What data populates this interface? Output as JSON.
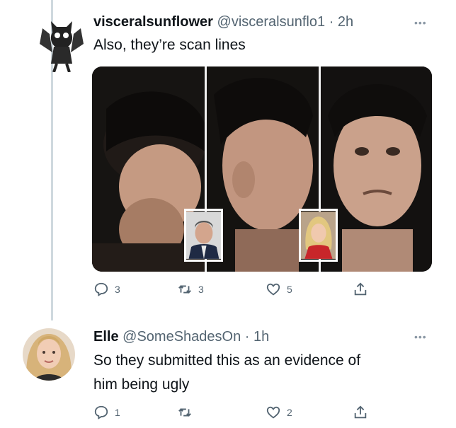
{
  "tweet1": {
    "display_name": "visceralsunflower",
    "handle": "@visceralsunflo1",
    "separator": "·",
    "time": "2h",
    "text": "Also, they’re scan lines",
    "replies": "3",
    "retweets": "3",
    "likes": "5"
  },
  "tweet2": {
    "display_name": "Elle",
    "handle": "@SomeShadesOn",
    "separator": "·",
    "time": "1h",
    "text_line1": "So they submitted this as an evidence of",
    "text_line2": "him being ugly",
    "replies": "1",
    "retweets": "",
    "likes": "2"
  },
  "icons": [
    "more-dots-icon",
    "reply-icon",
    "retweet-icon",
    "like-icon",
    "share-icon"
  ],
  "colors": {
    "muted": "#536471",
    "thread_line": "#cfd9de",
    "text": "#0f1419"
  }
}
